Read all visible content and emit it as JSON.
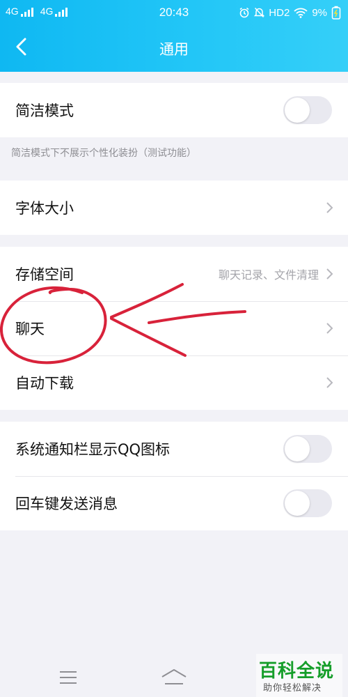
{
  "status_bar": {
    "net1": "4G",
    "net2": "4G",
    "time": "20:43",
    "hd": "HD2",
    "battery": "9%"
  },
  "nav": {
    "title": "通用"
  },
  "section1": {
    "simple_mode": {
      "label": "简洁模式",
      "toggle_on": false
    },
    "hint": "简洁模式下不展示个性化装扮（测试功能）"
  },
  "section2": {
    "font_size": {
      "label": "字体大小"
    }
  },
  "section3": {
    "storage": {
      "label": "存储空间",
      "value": "聊天记录、文件清理"
    },
    "chat": {
      "label": "聊天"
    },
    "auto_download": {
      "label": "自动下载"
    }
  },
  "section4": {
    "notify_icon": {
      "label": "系统通知栏显示QQ图标",
      "toggle_on": false
    },
    "enter_send": {
      "label": "回车键发送消息",
      "toggle_on": false
    }
  },
  "watermark": {
    "main": "百科全说",
    "sub": "助你轻松解决"
  },
  "colors": {
    "header": "#1ebef5",
    "page_bg": "#f2f2f7",
    "annotation": "#d8223a",
    "watermark_green": "#169e2a"
  },
  "icons": [
    "back-arrow-icon",
    "chevron-right-icon",
    "alarm-icon",
    "mute-icon",
    "wifi-icon",
    "battery-icon",
    "menu-icon",
    "home-icon"
  ]
}
